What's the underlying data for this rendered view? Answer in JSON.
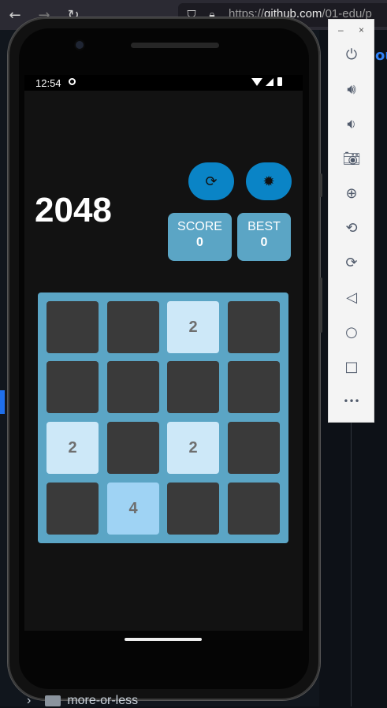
{
  "browser": {
    "url_prefix": "https://",
    "url_host": "github.com",
    "url_rest": "/01-edu/p"
  },
  "status": {
    "time": "12:54"
  },
  "app": {
    "title": "2048",
    "score_label": "SCORE",
    "score_value": "0",
    "best_label": "BEST",
    "best_value": "0"
  },
  "board": [
    [
      "",
      "",
      "2",
      ""
    ],
    [
      "",
      "",
      "",
      ""
    ],
    [
      "2",
      "",
      "2",
      ""
    ],
    [
      "",
      "4",
      "",
      ""
    ]
  ],
  "explorer": {
    "folder": "more-or-less"
  },
  "emulator": {
    "minimize": "–",
    "close": "×",
    "icons": [
      "power-icon",
      "volume-up-icon",
      "volume-down-icon",
      "camera-icon",
      "zoom-icon",
      "rotate-left-icon",
      "rotate-right-icon",
      "back-icon",
      "home-icon",
      "overview-icon",
      "more-icon"
    ]
  },
  "colors": {
    "tile_empty": "#3a3a3a",
    "tile_2": "#cde8f8",
    "tile_4": "#9fd3f4",
    "board": "#5ba5c5",
    "accent": "#0a84c6"
  }
}
